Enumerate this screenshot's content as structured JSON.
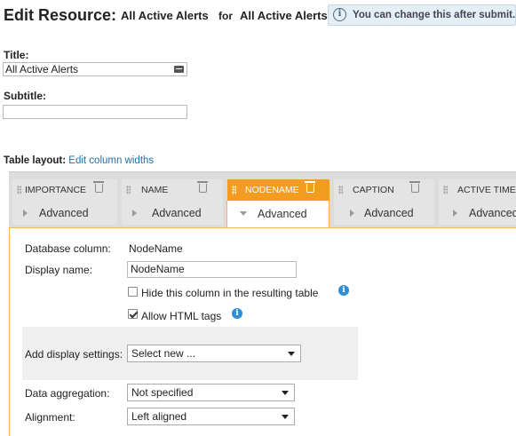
{
  "header": {
    "title": "Edit Resource:",
    "subject": "All Active Alerts",
    "for_word": "for",
    "resource": "All Active Alerts",
    "hint": "You can change this after submit.",
    "hint_icon": "info-circle-icon"
  },
  "form": {
    "title_label": "Title:",
    "title_value": "All Active Alerts",
    "subtitle_label": "Subtitle:",
    "subtitle_value": ""
  },
  "table_layout": {
    "label": "Table layout:",
    "edit_link": "Edit column widths"
  },
  "columns": [
    {
      "name": "IMPORTANCE",
      "toggle": "Advanced",
      "active": false
    },
    {
      "name": "NAME",
      "toggle": "Advanced",
      "active": false
    },
    {
      "name": "NODENAME",
      "toggle": "Advanced",
      "active": true
    },
    {
      "name": "CAPTION",
      "toggle": "Advanced",
      "active": false
    },
    {
      "name": "ACTIVE TIME",
      "toggle": "Advanced",
      "active": false
    }
  ],
  "panel": {
    "db_column_label": "Database column:",
    "db_column_value": "NodeName",
    "display_name_label": "Display name:",
    "display_name_value": "NodeName",
    "hide_column_label": "Hide this column in the resulting table",
    "hide_column_checked": false,
    "allow_html_label": "Allow HTML tags",
    "allow_html_checked": true,
    "add_display_label": "Add display settings:",
    "add_display_value": "Select new ...",
    "aggregation_label": "Data aggregation:",
    "aggregation_value": "Not specified",
    "alignment_label": "Alignment:",
    "alignment_value": "Left aligned"
  },
  "colors": {
    "accent": "#f39c1f",
    "link": "#1f6fa8",
    "info": "#2d8ed6"
  }
}
